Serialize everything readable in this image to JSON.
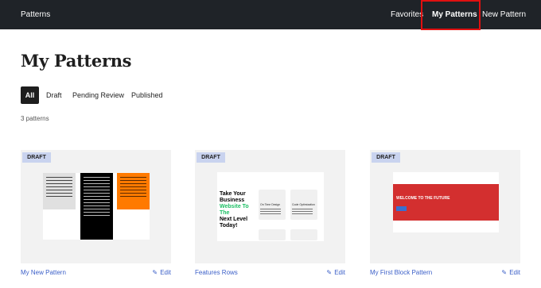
{
  "header": {
    "brand": "Patterns",
    "nav": {
      "favorites": "Favorites",
      "my_patterns": "My Patterns",
      "new_pattern": "New Pattern"
    },
    "highlight_color": "#e01010"
  },
  "page": {
    "title": "My Patterns",
    "count": "3 patterns"
  },
  "tabs": {
    "all": "All",
    "draft": "Draft",
    "pending": "Pending Review",
    "published": "Published"
  },
  "cards": [
    {
      "badge": "DRAFT",
      "name": "My New Pattern",
      "edit": "Edit",
      "thumbnail": {
        "columns": [
          {
            "background": "#e0e0e0"
          },
          {
            "background": "#000000"
          },
          {
            "background": "#ff7a00"
          }
        ]
      }
    },
    {
      "badge": "DRAFT",
      "name": "Features Rows",
      "edit": "Edit",
      "thumbnail": {
        "heading_line1": "Take Your",
        "heading_line2": "Business",
        "heading_line3": "Website To",
        "heading_line4": "The",
        "heading_line5": "Next Level",
        "heading_line6": "Today!",
        "box1_title": "On Time Design",
        "box2_title": "Code Optimization",
        "accent": "#1bbf63"
      }
    },
    {
      "badge": "DRAFT",
      "name": "My First Block Pattern",
      "edit": "Edit",
      "thumbnail": {
        "heading": "WELCOME TO THE FUTURE",
        "banner_color": "#d32f2f",
        "button_color": "#3a6fd0"
      }
    }
  ],
  "icons": {
    "edit": "pencil-icon"
  }
}
